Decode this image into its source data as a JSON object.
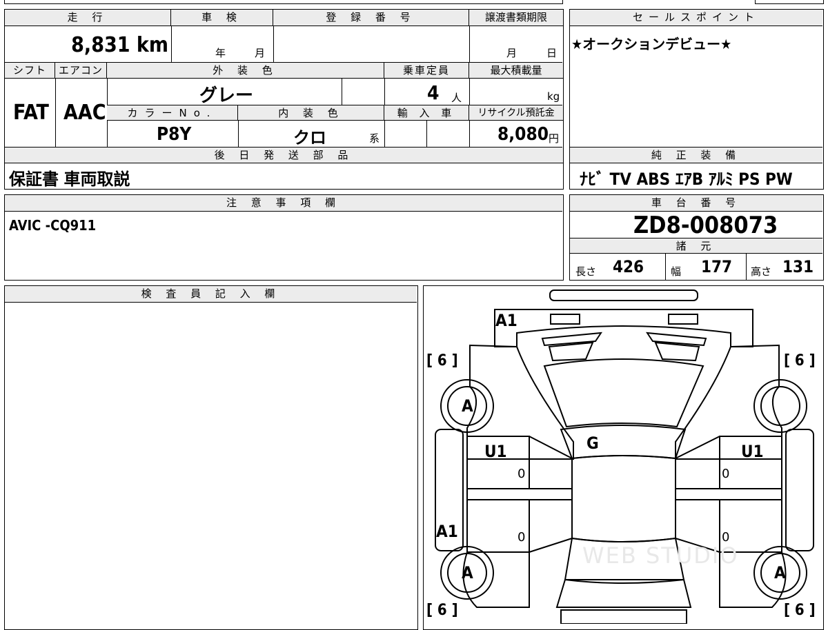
{
  "mileage": {
    "header": "走 行",
    "value": "8,831 km"
  },
  "inspection": {
    "header": "車 検",
    "year_unit": "年",
    "month_unit": "月"
  },
  "registration": {
    "header": "登 録 番 号",
    "value": ""
  },
  "transfer_deadline": {
    "header": "譲渡書類期限",
    "month_unit": "月",
    "day_unit": "日"
  },
  "shift": {
    "header": "シフト",
    "value": "FAT"
  },
  "aircon": {
    "header": "エアコン",
    "value": "AAC"
  },
  "exterior_color": {
    "header": "外 装 色",
    "value": "グレー"
  },
  "capacity": {
    "header": "乗車定員",
    "value": "4",
    "unit": "人"
  },
  "max_load": {
    "header": "最大積載量",
    "unit": "kg"
  },
  "color_no": {
    "header": "カラーNo.",
    "value": "P8Y"
  },
  "interior_color": {
    "header": "内 装 色",
    "value": "クロ",
    "suffix": "系"
  },
  "import": {
    "header": "輸 入 車"
  },
  "recycle": {
    "header": "リサイクル預託金",
    "value": "8,080",
    "unit": "円"
  },
  "later_parts": {
    "header": "後 日 発 送 部 品",
    "value": "保証書 車両取説"
  },
  "sales_point": {
    "header": "セールスポイント",
    "value": "★オークションデビュー★"
  },
  "equipment": {
    "header": "純 正 装 備",
    "value": "ﾅﾋﾞ TV ABS ｴｱB ｱﾙﾐ PS PW"
  },
  "notes": {
    "header": "注 意 事 項 欄",
    "value": "AVIC -CQ911"
  },
  "chassis": {
    "header": "車 台 番 号",
    "value": "ZD8-008073"
  },
  "specs": {
    "header": "諸 元",
    "length_label": "長さ",
    "length": "426",
    "width_label": "幅",
    "width": "177",
    "height_label": "高さ",
    "height": "131"
  },
  "inspector": {
    "header": "検 査 員 記 入 欄"
  },
  "diagram": {
    "marks": {
      "front_bumper": "A1",
      "tire_fl": "[ 6 ]",
      "tire_fr": "[ 6 ]",
      "tire_rl": "[ 6 ]",
      "tire_rr": "[ 6 ]",
      "wheel_fl": "A",
      "wheel_rl": "A",
      "wheel_rr": "A",
      "windshield": "G",
      "door_l": "U1",
      "door_r": "U1",
      "rocker_l": "A1",
      "z1": "0",
      "z2": "0",
      "z3": "0",
      "z4": "0"
    },
    "watermark": "WEB STUDIO"
  }
}
